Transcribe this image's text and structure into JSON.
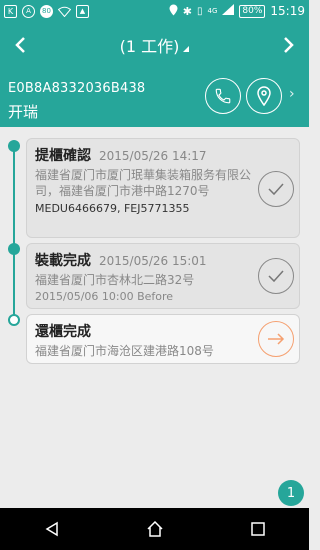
{
  "statusbar": {
    "left_icons": [
      "k-icon",
      "a-icon",
      "80-icon",
      "wifi-icon",
      "image-icon"
    ],
    "badge_80": "80",
    "network": "4G",
    "battery": "80%",
    "time": "15:19"
  },
  "appbar": {
    "title": "(1 工作)"
  },
  "header": {
    "container_no": "E0B8A8332036B438",
    "status": "开瑞"
  },
  "steps": [
    {
      "name": "提櫃確認",
      "datetime": "2015/05/26 14:17",
      "address": "福建省厦门市厦门珉華集装箱服务有限公司，福建省厦门市港中路1270号",
      "refs": "MEDU6466679, FEJ5771355"
    },
    {
      "name": "裝載完成",
      "datetime": "2015/05/26 15:01",
      "address": "福建省厦门市杏林北二路32号",
      "before": "2015/05/06 10:00 Before"
    },
    {
      "name": "還櫃完成",
      "address": "福建省厦门市海沧区建港路108号"
    }
  ],
  "badge_count": "1",
  "colors": {
    "primary": "#26a69a",
    "accent": "#f5a070"
  }
}
